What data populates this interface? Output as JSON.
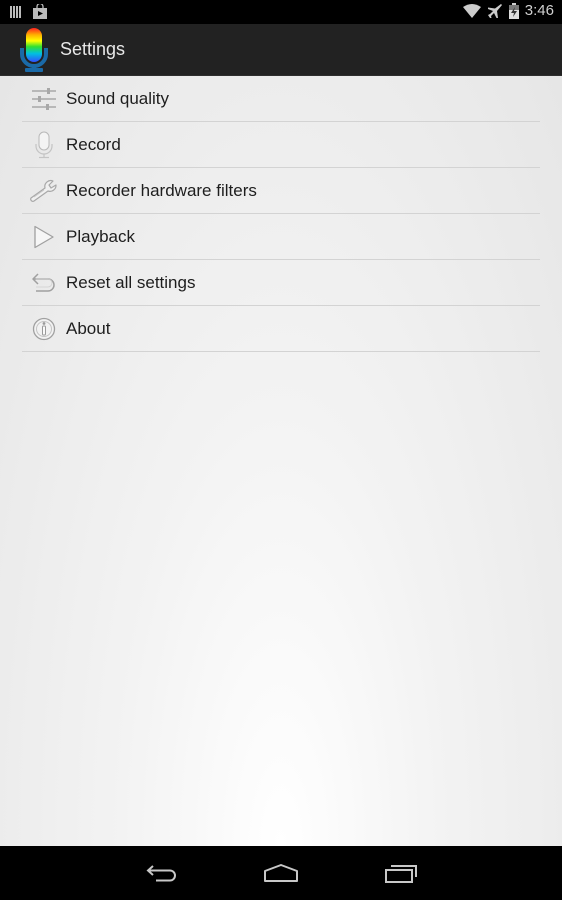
{
  "status_bar": {
    "time": "3:46",
    "left_icons": [
      "barcode-icon",
      "play-store-icon"
    ],
    "right_icons": [
      "wifi-icon",
      "airplane-mode-icon",
      "battery-charging-icon"
    ]
  },
  "action_bar": {
    "title": "Settings",
    "app_icon": "rainbow-microphone-icon"
  },
  "settings": {
    "items": [
      {
        "label": "Sound quality",
        "icon": "sliders-icon"
      },
      {
        "label": "Record",
        "icon": "microphone-icon"
      },
      {
        "label": "Recorder hardware filters",
        "icon": "wrench-icon"
      },
      {
        "label": "Playback",
        "icon": "play-icon"
      },
      {
        "label": "Reset all settings",
        "icon": "undo-icon"
      },
      {
        "label": "About",
        "icon": "info-icon"
      }
    ]
  },
  "nav_bar": {
    "buttons": [
      "back",
      "home",
      "recent-apps"
    ]
  }
}
